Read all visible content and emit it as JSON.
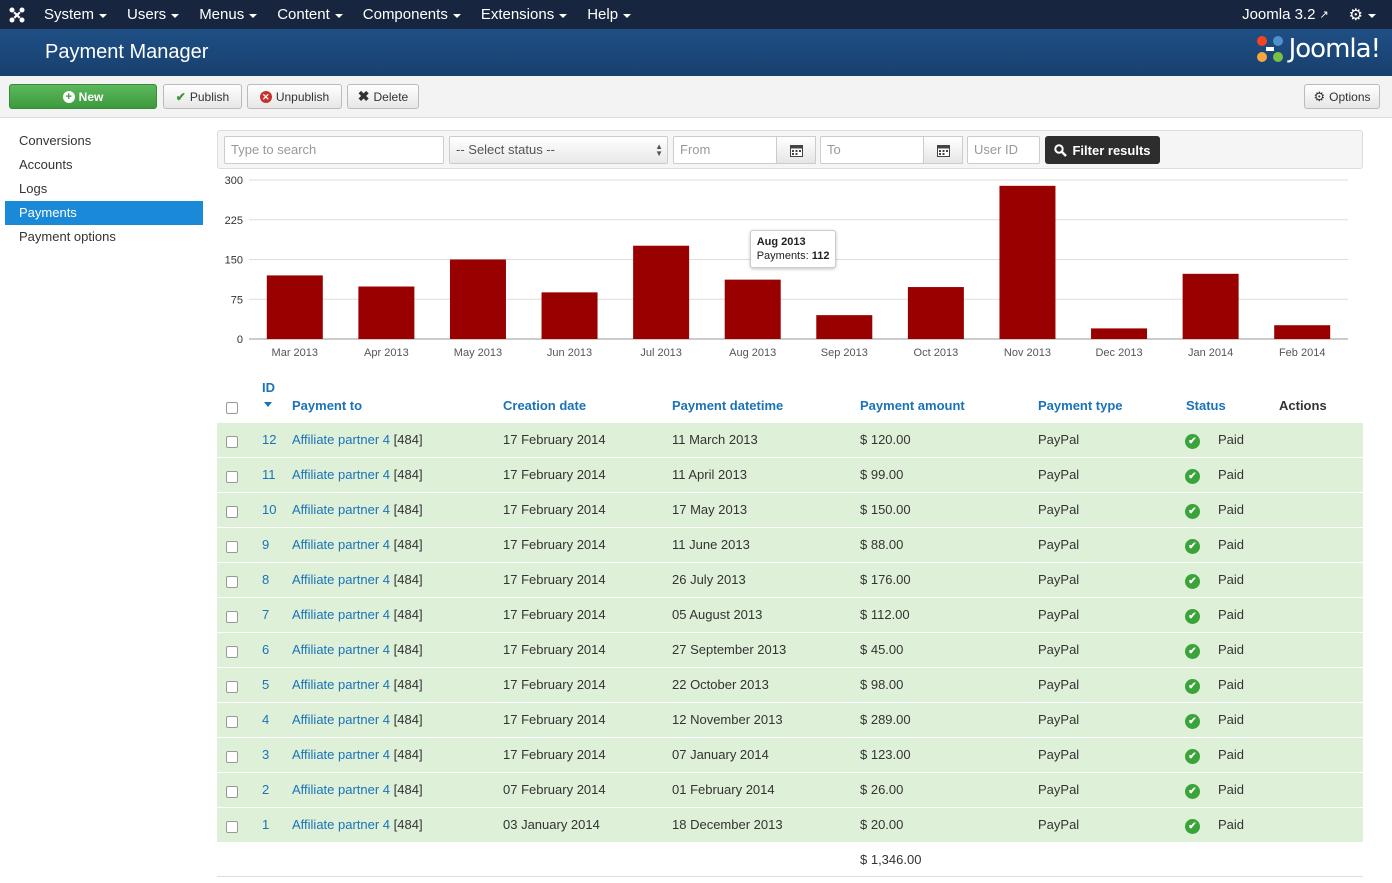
{
  "topnav": {
    "menus": [
      "System",
      "Users",
      "Menus",
      "Content",
      "Components",
      "Extensions",
      "Help"
    ],
    "version": "Joomla 3.2"
  },
  "header": {
    "title": "Payment Manager",
    "brand": "Joomla!"
  },
  "toolbar": {
    "new_label": "New",
    "publish_label": "Publish",
    "unpublish_label": "Unpublish",
    "delete_label": "Delete",
    "options_label": "Options"
  },
  "sidebar": {
    "items": [
      {
        "label": "Conversions"
      },
      {
        "label": "Accounts"
      },
      {
        "label": "Logs"
      },
      {
        "label": "Payments"
      },
      {
        "label": "Payment options"
      }
    ]
  },
  "filters": {
    "search_placeholder": "Type to search",
    "status_selected": "-- Select status --",
    "from_placeholder": "From",
    "to_placeholder": "To",
    "userid_placeholder": "User ID",
    "filter_label": "Filter results"
  },
  "chart_data": {
    "type": "bar",
    "categories": [
      "Mar 2013",
      "Apr 2013",
      "May 2013",
      "Jun 2013",
      "Jul 2013",
      "Aug 2013",
      "Sep 2013",
      "Oct 2013",
      "Nov 2013",
      "Dec 2013",
      "Jan 2014",
      "Feb 2014"
    ],
    "values": [
      120,
      99,
      150,
      88,
      176,
      112,
      45,
      98,
      289,
      20,
      123,
      26
    ],
    "ylim": [
      0,
      300
    ],
    "yticks": [
      0,
      75,
      150,
      225,
      300
    ],
    "grid": true,
    "bar_color": "#990000",
    "tooltip": {
      "month": "Aug 2013",
      "label": "Payments:",
      "value": "112"
    }
  },
  "table": {
    "columns": {
      "id": "ID",
      "payment_to": "Payment to",
      "creation_date": "Creation date",
      "payment_datetime": "Payment datetime",
      "payment_amount": "Payment amount",
      "payment_type": "Payment type",
      "status": "Status",
      "actions": "Actions"
    },
    "rows": [
      {
        "id": "12",
        "to": "Affiliate partner 4",
        "ref": "[484]",
        "created": "17 February 2014",
        "paid": "11 March 2013",
        "amount": "$ 120.00",
        "type": "PayPal",
        "status": "Paid"
      },
      {
        "id": "11",
        "to": "Affiliate partner 4",
        "ref": "[484]",
        "created": "17 February 2014",
        "paid": "11 April 2013",
        "amount": "$ 99.00",
        "type": "PayPal",
        "status": "Paid"
      },
      {
        "id": "10",
        "to": "Affiliate partner 4",
        "ref": "[484]",
        "created": "17 February 2014",
        "paid": "17 May 2013",
        "amount": "$ 150.00",
        "type": "PayPal",
        "status": "Paid"
      },
      {
        "id": "9",
        "to": "Affiliate partner 4",
        "ref": "[484]",
        "created": "17 February 2014",
        "paid": "11 June 2013",
        "amount": "$ 88.00",
        "type": "PayPal",
        "status": "Paid"
      },
      {
        "id": "8",
        "to": "Affiliate partner 4",
        "ref": "[484]",
        "created": "17 February 2014",
        "paid": "26 July 2013",
        "amount": "$ 176.00",
        "type": "PayPal",
        "status": "Paid"
      },
      {
        "id": "7",
        "to": "Affiliate partner 4",
        "ref": "[484]",
        "created": "17 February 2014",
        "paid": "05 August 2013",
        "amount": "$ 112.00",
        "type": "PayPal",
        "status": "Paid"
      },
      {
        "id": "6",
        "to": "Affiliate partner 4",
        "ref": "[484]",
        "created": "17 February 2014",
        "paid": "27 September 2013",
        "amount": "$ 45.00",
        "type": "PayPal",
        "status": "Paid"
      },
      {
        "id": "5",
        "to": "Affiliate partner 4",
        "ref": "[484]",
        "created": "17 February 2014",
        "paid": "22 October 2013",
        "amount": "$ 98.00",
        "type": "PayPal",
        "status": "Paid"
      },
      {
        "id": "4",
        "to": "Affiliate partner 4",
        "ref": "[484]",
        "created": "17 February 2014",
        "paid": "12 November 2013",
        "amount": "$ 289.00",
        "type": "PayPal",
        "status": "Paid"
      },
      {
        "id": "3",
        "to": "Affiliate partner 4",
        "ref": "[484]",
        "created": "17 February 2014",
        "paid": "07 January 2014",
        "amount": "$ 123.00",
        "type": "PayPal",
        "status": "Paid"
      },
      {
        "id": "2",
        "to": "Affiliate partner 4",
        "ref": "[484]",
        "created": "07 February 2014",
        "paid": "01 February 2014",
        "amount": "$ 26.00",
        "type": "PayPal",
        "status": "Paid"
      },
      {
        "id": "1",
        "to": "Affiliate partner 4",
        "ref": "[484]",
        "created": "03 January 2014",
        "paid": "18 December 2013",
        "amount": "$ 20.00",
        "type": "PayPal",
        "status": "Paid"
      }
    ],
    "total": "$ 1,346.00"
  }
}
